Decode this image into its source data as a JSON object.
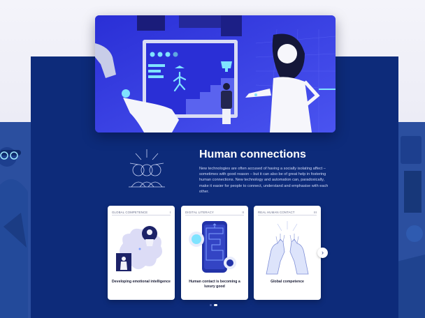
{
  "section": {
    "title": "Human connections",
    "body": "New technologies are often accused of having a socially isolating affect – sometimes with good reason – but it can also be of great help in fostering human connections. New technology and automation can, paradoxically, make it easier for people to connect, understand and emphasise with each other."
  },
  "cards": [
    {
      "tag": "GLOBAL COMPETENCE",
      "num": "I",
      "caption": "Developing emotional intelligence"
    },
    {
      "tag": "DIGITAL LITERACY",
      "num": "II",
      "caption": "Human contact is becoming a luxury good"
    },
    {
      "tag": "REAL HUMAN CONTACT",
      "num": "III",
      "caption": "Global competence"
    }
  ],
  "carousel": {
    "next_icon": "›",
    "pages": 2,
    "active_page": 1
  },
  "colors": {
    "panel": "#0d2b7a",
    "side_panel": "#2b4f9f",
    "hero_bg": "#3b3be0",
    "accent_cyan": "#7fe3ff"
  }
}
